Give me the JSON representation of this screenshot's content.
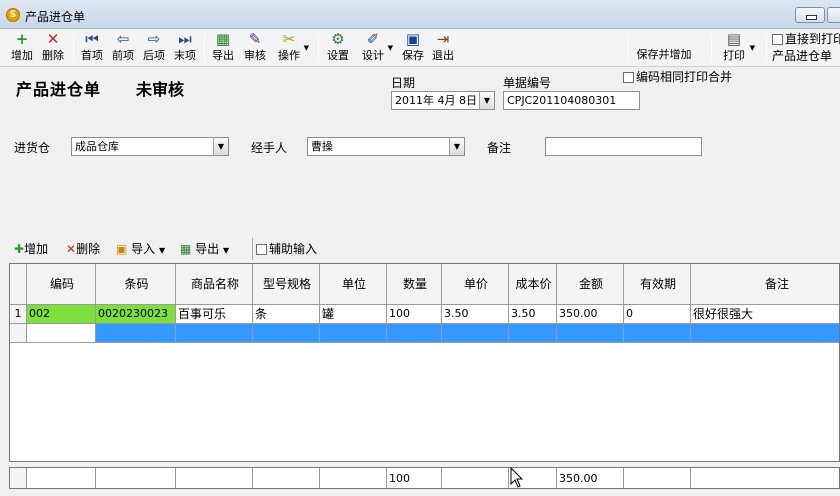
{
  "window": {
    "title": "产品进仓单",
    "icon": "S"
  },
  "toolbar": {
    "items": [
      {
        "name": "add",
        "label": "增加",
        "icon": "+"
      },
      {
        "name": "delete",
        "label": "删除",
        "icon": "✕"
      },
      {
        "name": "first",
        "label": "首项",
        "icon": "⏮"
      },
      {
        "name": "prev",
        "label": "前项",
        "icon": "⇦"
      },
      {
        "name": "next",
        "label": "后项",
        "icon": "⇨"
      },
      {
        "name": "last",
        "label": "末项",
        "icon": "⏭"
      },
      {
        "name": "export",
        "label": "导出",
        "icon": "▦"
      },
      {
        "name": "audit",
        "label": "审核",
        "icon": "✎"
      },
      {
        "name": "operate",
        "label": "操作",
        "icon": "✂"
      },
      {
        "name": "settings",
        "label": "设置",
        "icon": "⚙"
      },
      {
        "name": "design",
        "label": "设计",
        "icon": "✐"
      },
      {
        "name": "save",
        "label": "保存",
        "icon": "▣"
      },
      {
        "name": "exit",
        "label": "退出",
        "icon": "⇥"
      },
      {
        "name": "save-and-add",
        "label": "保存并增加"
      },
      {
        "name": "print",
        "label": "打印",
        "icon": "▤"
      }
    ],
    "direct_print_label": "直接到打印",
    "print_template": "产品进仓单"
  },
  "header": {
    "title": "产品进仓单",
    "status": "未审核",
    "date_label": "日期",
    "date_value": "2011年 4月 8日",
    "docno_label": "单据编号",
    "docno_value": "CPJC201104080301",
    "merge_print_label": "编码相同打印合并"
  },
  "form": {
    "warehouse_label": "进货仓",
    "warehouse_value": "成品仓库",
    "handler_label": "经手人",
    "handler_value": "曹操",
    "remark_label": "备注",
    "remark_value": ""
  },
  "subtoolbar": {
    "add": "增加",
    "delete": "删除",
    "import": "导入",
    "export": "导出",
    "assist": "辅助输入"
  },
  "grid": {
    "columns": [
      "编码",
      "条码",
      "商品名称",
      "型号规格",
      "单位",
      "数量",
      "单价",
      "成本价",
      "金额",
      "有效期",
      "备注"
    ],
    "rows": [
      {
        "idx": "1",
        "code": "002",
        "barcode": "0020230023",
        "name": "百事可乐",
        "spec": "条",
        "unit": "罐",
        "qty": "100",
        "price": "3.50",
        "cost": "3.50",
        "amount": "350.00",
        "expiry": "0",
        "remark": "很好很强大"
      }
    ]
  },
  "footer": {
    "qty_total": "100",
    "amount_total": "350.00"
  },
  "colors": {
    "selected_row": "#3399ff",
    "barcode_cell": "#7ddf3a"
  }
}
